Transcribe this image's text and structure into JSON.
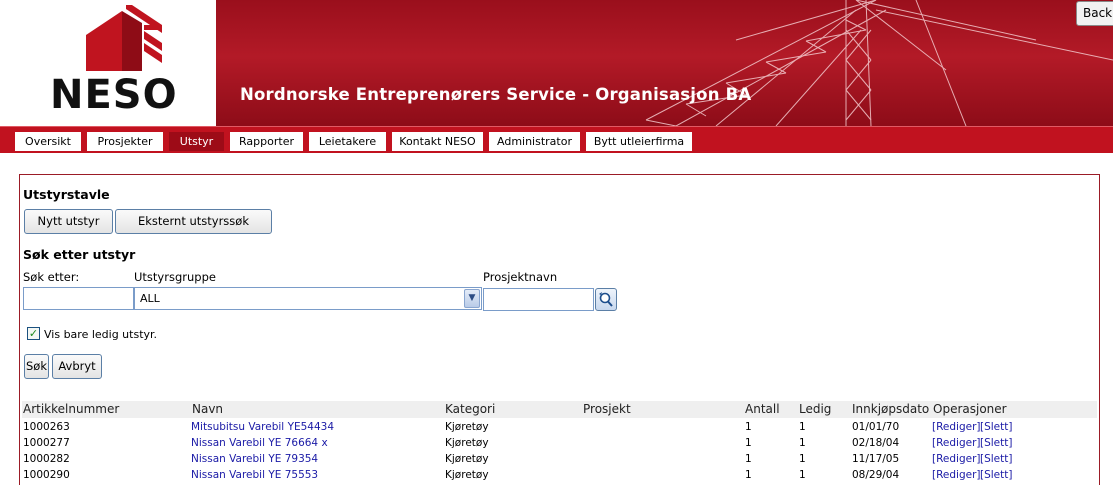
{
  "header": {
    "logo_text": "NESO",
    "banner_title": "Nordnorske Entreprenørers Service - Organisasjon BA",
    "back_label": "Back"
  },
  "nav": {
    "items": [
      {
        "label": "Oversikt"
      },
      {
        "label": "Prosjekter"
      },
      {
        "label": "Utstyr"
      },
      {
        "label": "Rapporter"
      },
      {
        "label": "Leietakere"
      },
      {
        "label": "Kontakt NESO"
      },
      {
        "label": "Administrator"
      },
      {
        "label": "Bytt utleierfirma"
      }
    ],
    "active": "Utstyr"
  },
  "page": {
    "title": "Utstyrstavle",
    "new_button": "Nytt utstyr",
    "external_button": "Eksternt utstyrssøk",
    "search_title": "Søk etter utstyr"
  },
  "search": {
    "search_label": "Søk etter:",
    "search_value": "",
    "group_label": "Utstyrsgruppe",
    "group_selected": "ALL",
    "project_label": "Prosjektnavn",
    "project_value": "",
    "only_available_label": "Vis bare ledig utstyr.",
    "only_available_checked": true,
    "search_button": "Søk",
    "cancel_button": "Avbryt"
  },
  "table": {
    "headers": [
      "Artikkelnummer",
      "Navn",
      "Kategori",
      "Prosjekt",
      "Antall",
      "Ledig",
      "Innkjøpsdato",
      "Operasjoner"
    ],
    "rows": [
      {
        "article": "1000263",
        "name": "Mitsubitsu Varebil YE54434",
        "category": "Kjøretøy",
        "project": "",
        "qty": "1",
        "available": "1",
        "date": "01/01/70",
        "edit": "[Rediger]",
        "delete": "[Slett]"
      },
      {
        "article": "1000277",
        "name": "Nissan Varebil YE 76664 x",
        "category": "Kjøretøy",
        "project": "",
        "qty": "1",
        "available": "1",
        "date": "02/18/04",
        "edit": "[Rediger]",
        "delete": "[Slett]"
      },
      {
        "article": "1000282",
        "name": "Nissan Varebil YE 79354",
        "category": "Kjøretøy",
        "project": "",
        "qty": "1",
        "available": "1",
        "date": "11/17/05",
        "edit": "[Rediger]",
        "delete": "[Slett]"
      },
      {
        "article": "1000290",
        "name": "Nissan Varebil YE 75553",
        "category": "Kjøretøy",
        "project": "",
        "qty": "1",
        "available": "1",
        "date": "08/29/04",
        "edit": "[Rediger]",
        "delete": "[Slett]"
      }
    ]
  },
  "icons": {
    "logo": "house-logo-icon",
    "select_arrow": "chevron-down-icon",
    "project_lookup": "search-lookup-icon",
    "checkbox": "checkmark-icon"
  },
  "colors": {
    "brand_red": "#b31a27",
    "nav_red": "#c1121f",
    "active_tab": "#9d0b17",
    "link": "#1a1aa6"
  }
}
